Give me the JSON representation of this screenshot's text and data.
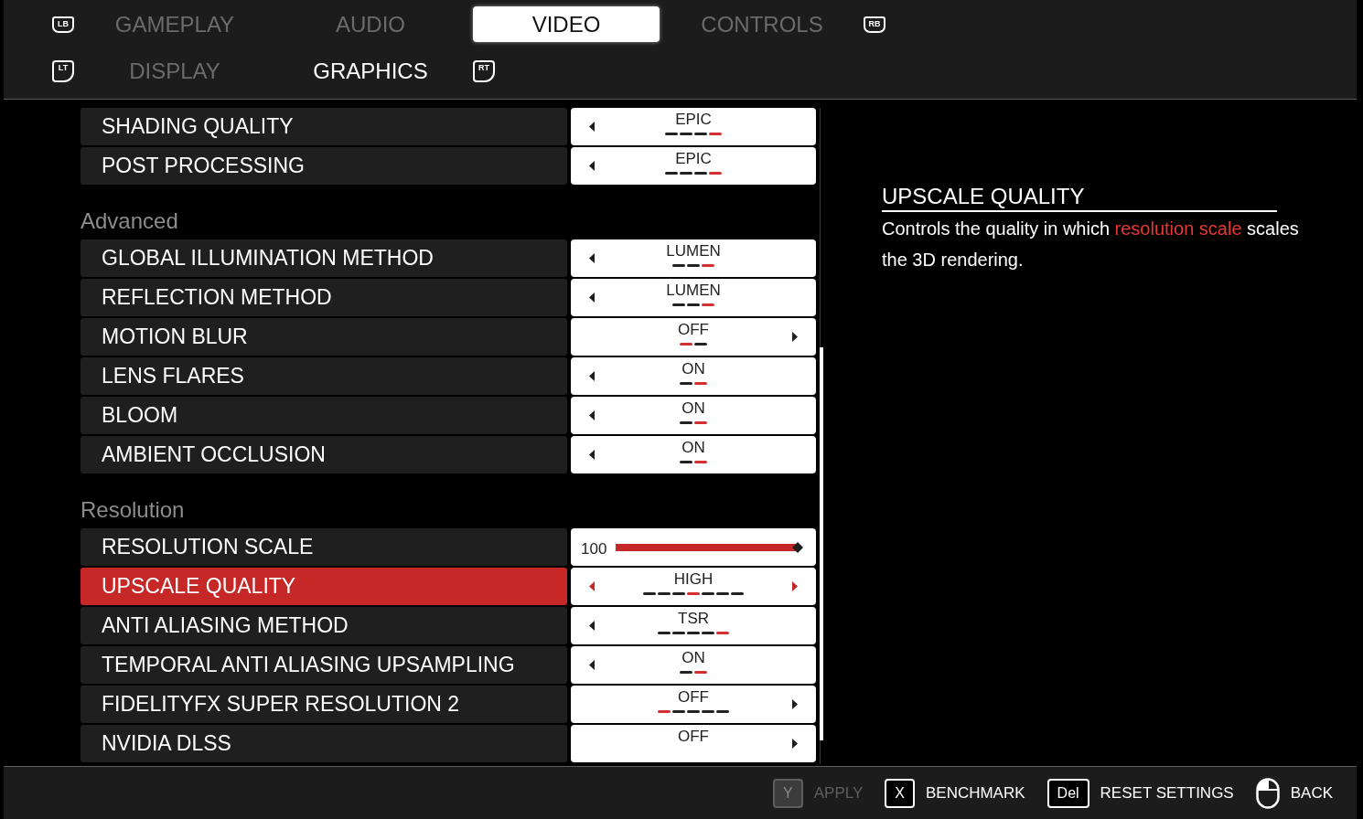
{
  "top_tabs": {
    "prev_hint": "LB",
    "next_hint": "RB",
    "items": [
      {
        "label": "GAMEPLAY",
        "selected": false
      },
      {
        "label": "AUDIO",
        "selected": false
      },
      {
        "label": "VIDEO",
        "selected": true
      },
      {
        "label": "CONTROLS",
        "selected": false
      }
    ]
  },
  "sub_tabs": {
    "prev_hint": "LT",
    "next_hint": "RT",
    "items": [
      {
        "label": "DISPLAY",
        "selected": false
      },
      {
        "label": "GRAPHICS",
        "selected": true
      }
    ]
  },
  "settings": {
    "sections": [
      {
        "rows": [
          {
            "kind": "option",
            "label": "SHADING QUALITY",
            "value": "EPIC",
            "selected": false,
            "has_previous": true,
            "has_next": false,
            "steps": [
              {
                "selected": false
              },
              {
                "selected": false
              },
              {
                "selected": false
              },
              {
                "selected": true
              }
            ]
          },
          {
            "kind": "option",
            "label": "POST PROCESSING",
            "value": "EPIC",
            "selected": false,
            "has_previous": true,
            "has_next": false,
            "steps": [
              {
                "selected": false
              },
              {
                "selected": false
              },
              {
                "selected": false
              },
              {
                "selected": true
              }
            ]
          }
        ]
      },
      {
        "title": "Advanced",
        "rows": [
          {
            "kind": "option",
            "label": "GLOBAL ILLUMINATION METHOD",
            "value": "LUMEN",
            "selected": false,
            "has_previous": true,
            "has_next": false,
            "steps": [
              {
                "selected": false
              },
              {
                "selected": false
              },
              {
                "selected": true
              }
            ]
          },
          {
            "kind": "option",
            "label": "REFLECTION METHOD",
            "value": "LUMEN",
            "selected": false,
            "has_previous": true,
            "has_next": false,
            "steps": [
              {
                "selected": false
              },
              {
                "selected": false
              },
              {
                "selected": true
              }
            ]
          },
          {
            "kind": "option",
            "label": "MOTION BLUR",
            "value": "OFF",
            "selected": false,
            "has_previous": false,
            "has_next": true,
            "steps": [
              {
                "selected": true
              },
              {
                "selected": false
              }
            ]
          },
          {
            "kind": "option",
            "label": "LENS FLARES",
            "value": "ON",
            "selected": false,
            "has_previous": true,
            "has_next": false,
            "steps": [
              {
                "selected": false
              },
              {
                "selected": true
              }
            ]
          },
          {
            "kind": "option",
            "label": "BLOOM",
            "value": "ON",
            "selected": false,
            "has_previous": true,
            "has_next": false,
            "steps": [
              {
                "selected": false
              },
              {
                "selected": true
              }
            ]
          },
          {
            "kind": "option",
            "label": "AMBIENT OCCLUSION",
            "value": "ON",
            "selected": false,
            "has_previous": true,
            "has_next": false,
            "steps": [
              {
                "selected": false
              },
              {
                "selected": true
              }
            ]
          }
        ]
      },
      {
        "title": "Resolution",
        "rows": [
          {
            "kind": "slider",
            "label": "RESOLUTION SCALE",
            "value": "100",
            "level": 1,
            "selected": false
          },
          {
            "kind": "option",
            "label": "UPSCALE QUALITY",
            "value": "HIGH",
            "selected": true,
            "has_previous": true,
            "has_next": true,
            "steps": [
              {
                "selected": false
              },
              {
                "selected": false
              },
              {
                "selected": false
              },
              {
                "selected": true
              },
              {
                "selected": false
              },
              {
                "selected": false
              },
              {
                "selected": false
              }
            ]
          },
          {
            "kind": "option",
            "label": "ANTI ALIASING METHOD",
            "value": "TSR",
            "selected": false,
            "has_previous": true,
            "has_next": false,
            "steps": [
              {
                "selected": false
              },
              {
                "selected": false
              },
              {
                "selected": false
              },
              {
                "selected": false
              },
              {
                "selected": true
              }
            ]
          },
          {
            "kind": "option",
            "label": "TEMPORAL ANTI ALIASING UPSAMPLING",
            "value": "ON",
            "selected": false,
            "has_previous": true,
            "has_next": false,
            "steps": [
              {
                "selected": false
              },
              {
                "selected": true
              }
            ]
          },
          {
            "kind": "option",
            "label": "FIDELITYFX SUPER RESOLUTION 2",
            "value": "OFF",
            "selected": false,
            "has_previous": false,
            "has_next": true,
            "steps": [
              {
                "selected": true
              },
              {
                "selected": false
              },
              {
                "selected": false
              },
              {
                "selected": false
              },
              {
                "selected": false
              }
            ]
          },
          {
            "kind": "option",
            "label": "NVIDIA DLSS",
            "value": "OFF",
            "selected": false,
            "has_previous": false,
            "has_next": true
          }
        ]
      }
    ]
  },
  "description": {
    "title": "UPSCALE QUALITY",
    "text": [
      {
        "text": "Controls the quality in which ",
        "highlight": false
      },
      {
        "text": "resolution scale",
        "highlight": true
      },
      {
        "text": " scales the 3D rendering.",
        "highlight": false
      }
    ]
  },
  "footer": {
    "actions": [
      {
        "kind": "key",
        "key": "Y",
        "label": "APPLY",
        "disabled": true
      },
      {
        "kind": "key",
        "key": "X",
        "label": "BENCHMARK",
        "disabled": false
      },
      {
        "kind": "key",
        "key": "Del",
        "label": "RESET SETTINGS",
        "disabled": false
      },
      {
        "kind": "mouse",
        "label": "BACK",
        "disabled": false
      }
    ]
  }
}
